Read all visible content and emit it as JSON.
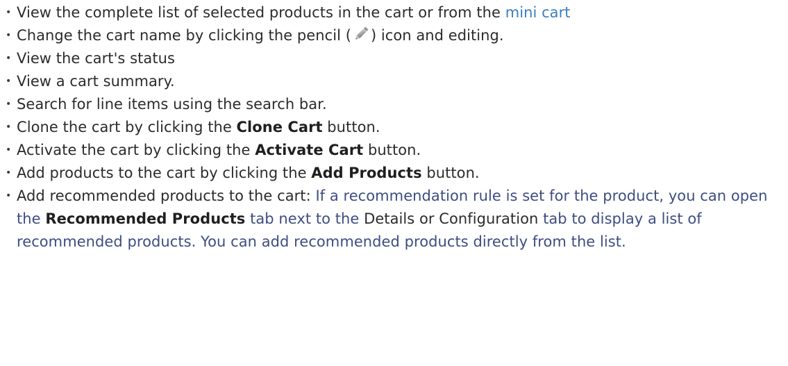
{
  "items": [
    {
      "text": "View the complete list of selected products in the cart or from the ",
      "link": "mini cart"
    },
    {
      "before": "Change the cart name by clicking the pencil (",
      "icon": "pencil-icon",
      "after": ") icon and editing."
    },
    {
      "text": "View the cart's status"
    },
    {
      "text": "View a cart summary."
    },
    {
      "text": "Search for line items using the search bar."
    },
    {
      "before": "Clone the cart by clicking the ",
      "bold": "Clone Cart",
      "after": " button."
    },
    {
      "before": "Activate the cart by clicking the ",
      "bold": "Activate Cart",
      "after": " button."
    },
    {
      "before": "Add products to the cart by clicking the ",
      "bold": "Add Products",
      "after": " button."
    },
    {
      "part1": "Add recommended products to the cart: ",
      "part2": "If a recommendation rule is set for the product, you can open the ",
      "bold": "Recommended Products",
      "part3": " tab next to the ",
      "part4": "Details",
      "part5": " or Configuration",
      "part6": " tab to display a list of recommended products. You can add recommended products directly from the list."
    }
  ],
  "colors": {
    "link": "#3a7fbf",
    "body_text": "#2b2b2b",
    "blue_text": "#3e4d82"
  }
}
